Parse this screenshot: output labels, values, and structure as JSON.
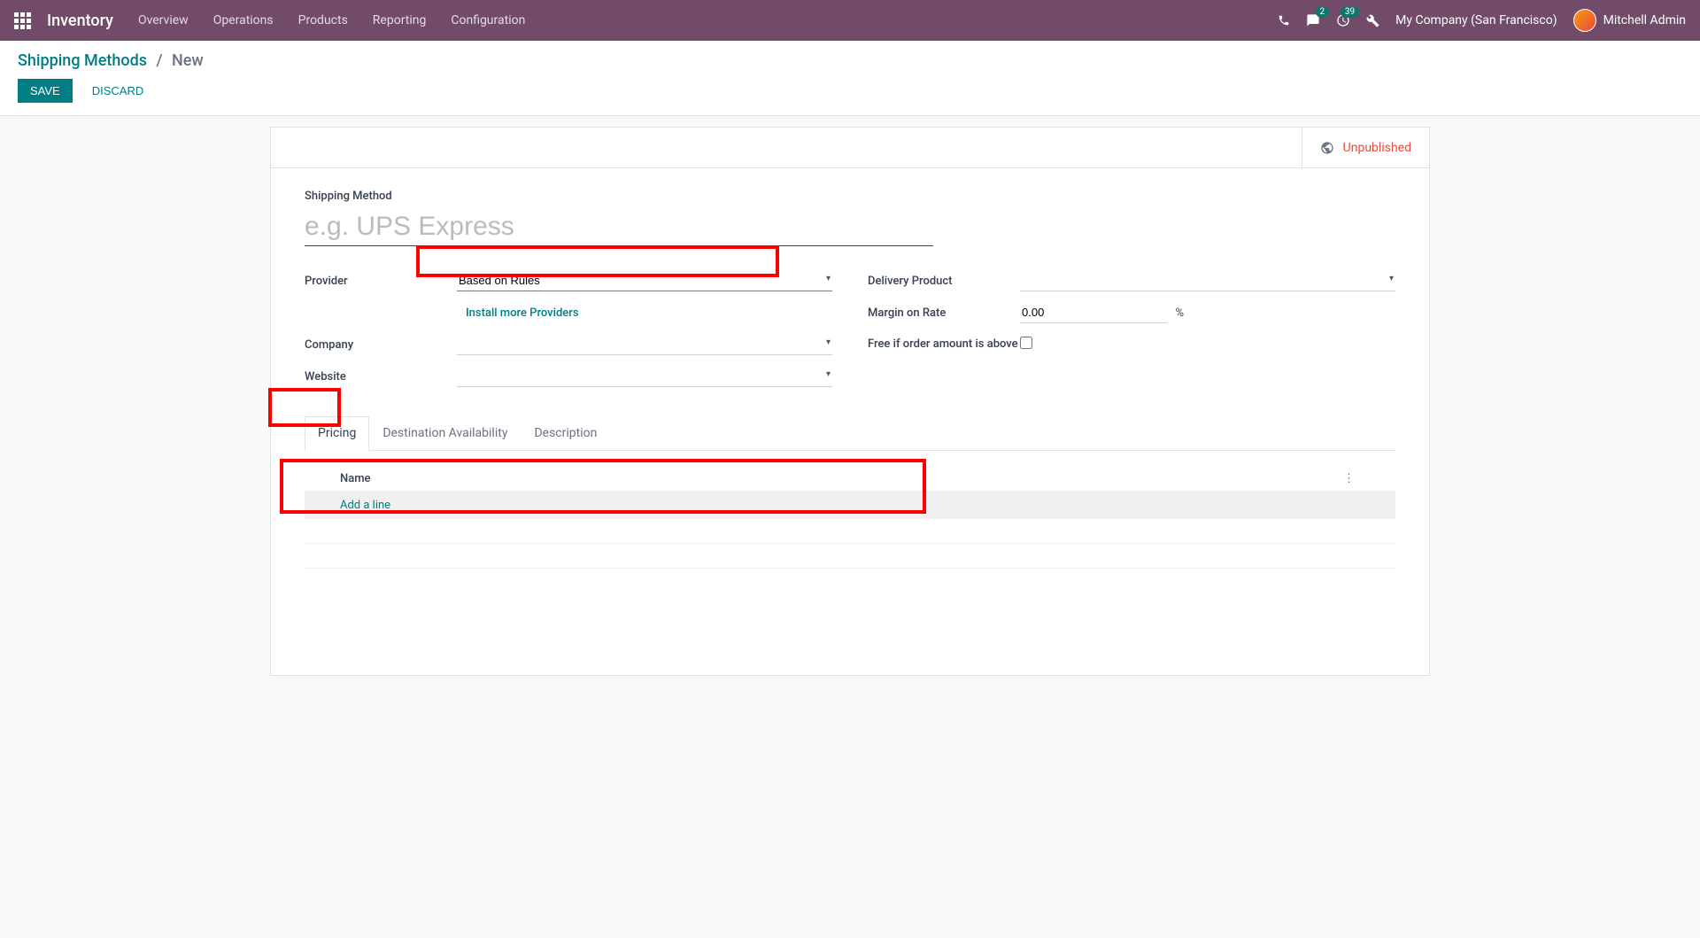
{
  "navbar": {
    "brand": "Inventory",
    "links": [
      "Overview",
      "Operations",
      "Products",
      "Reporting",
      "Configuration"
    ],
    "chat_badge": "2",
    "activity_badge": "39",
    "company": "My Company (San Francisco)",
    "user": "Mitchell Admin"
  },
  "breadcrumb": {
    "parent": "Shipping Methods",
    "current": "New"
  },
  "buttons": {
    "save": "SAVE",
    "discard": "DISCARD"
  },
  "header": {
    "unpublished": "Unpublished"
  },
  "form": {
    "shipping_method_label": "Shipping Method",
    "shipping_method_placeholder": "e.g. UPS Express",
    "provider_label": "Provider",
    "provider_value": "Based on Rules",
    "install_providers": "Install more Providers",
    "company_label": "Company",
    "website_label": "Website",
    "delivery_product_label": "Delivery Product",
    "margin_label": "Margin on Rate",
    "margin_value": "0.00",
    "margin_unit": "%",
    "free_label": "Free if order amount is above"
  },
  "tabs": [
    "Pricing",
    "Destination Availability",
    "Description"
  ],
  "pricing": {
    "col_name": "Name",
    "add_line": "Add a line"
  }
}
